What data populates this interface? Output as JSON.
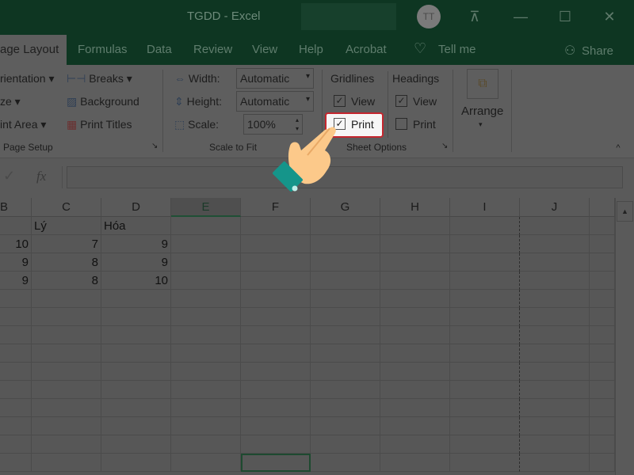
{
  "window": {
    "title": "TGDD  -  Excel",
    "avatar": "TT"
  },
  "tabs": {
    "active": "age Layout",
    "items": [
      "Formulas",
      "Data",
      "Review",
      "View",
      "Help",
      "Acrobat"
    ],
    "tell_me": "Tell me",
    "share": "Share"
  },
  "ribbon": {
    "page_setup": {
      "orientation": "rientation",
      "size": "ze",
      "print_area": "int Area",
      "breaks": "Breaks",
      "background": "Background",
      "print_titles": "Print Titles",
      "label": "Page Setup"
    },
    "scale_to_fit": {
      "width_label": "Width:",
      "width_value": "Automatic",
      "height_label": "Height:",
      "height_value": "Automatic",
      "scale_label": "Scale:",
      "scale_value": "100%",
      "label": "Scale to Fit"
    },
    "sheet_options": {
      "gridlines": "Gridlines",
      "headings": "Headings",
      "gridlines_view": "View",
      "gridlines_view_checked": true,
      "gridlines_print": "Print",
      "gridlines_print_checked": true,
      "headings_view": "View",
      "headings_view_checked": true,
      "headings_print": "Print",
      "headings_print_checked": false,
      "label": "Sheet Options"
    },
    "arrange": {
      "label": "Arrange"
    }
  },
  "formula_bar": {
    "fx": "fx",
    "value": ""
  },
  "sheet": {
    "columns": [
      "B",
      "C",
      "D",
      "E",
      "F",
      "G",
      "H",
      "I",
      "J"
    ],
    "selected_column": "E",
    "rows": [
      [
        "",
        "Lý",
        "Hóa"
      ],
      [
        "10",
        "7",
        "9"
      ],
      [
        "9",
        "8",
        "9"
      ],
      [
        "9",
        "8",
        "10"
      ]
    ]
  },
  "colors": {
    "title_bar": "#0e3622",
    "highlight_border": "#c4262e",
    "hand": "#fcc98a",
    "cuff": "#15958a"
  }
}
